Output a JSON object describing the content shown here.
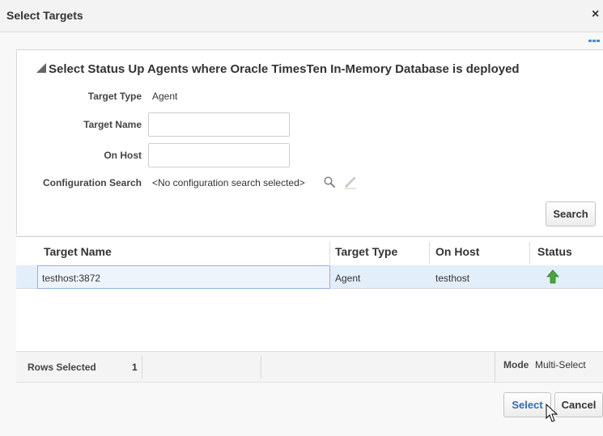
{
  "dialog": {
    "title": "Select Targets",
    "close_glyph": "×"
  },
  "panel": {
    "heading": "Select Status Up Agents where Oracle TimesTen In-Memory Database is deployed",
    "fields": {
      "target_type_label": "Target Type",
      "target_type_value": "Agent",
      "target_name_label": "Target Name",
      "target_name_value": "",
      "on_host_label": "On Host",
      "on_host_value": "",
      "config_search_label": "Configuration Search",
      "config_search_value": "<No configuration search selected>"
    },
    "search_button": "Search"
  },
  "table": {
    "columns": [
      "Target Name",
      "Target Type",
      "On Host",
      "Status"
    ],
    "rows": [
      {
        "target_name": "testhost:3872",
        "target_type": "Agent",
        "on_host": "testhost",
        "status_icon": "status-up-arrow-icon"
      }
    ]
  },
  "footer": {
    "rows_selected_label": "Rows Selected",
    "rows_selected_value": "1",
    "mode_label": "Mode",
    "mode_value": "Multi-Select"
  },
  "actions": {
    "select_label": "Select",
    "cancel_label": "Cancel"
  },
  "colors": {
    "accent": "#2f6db5",
    "status_up": "#4aa83a",
    "selected_row": "#e3eefb"
  }
}
